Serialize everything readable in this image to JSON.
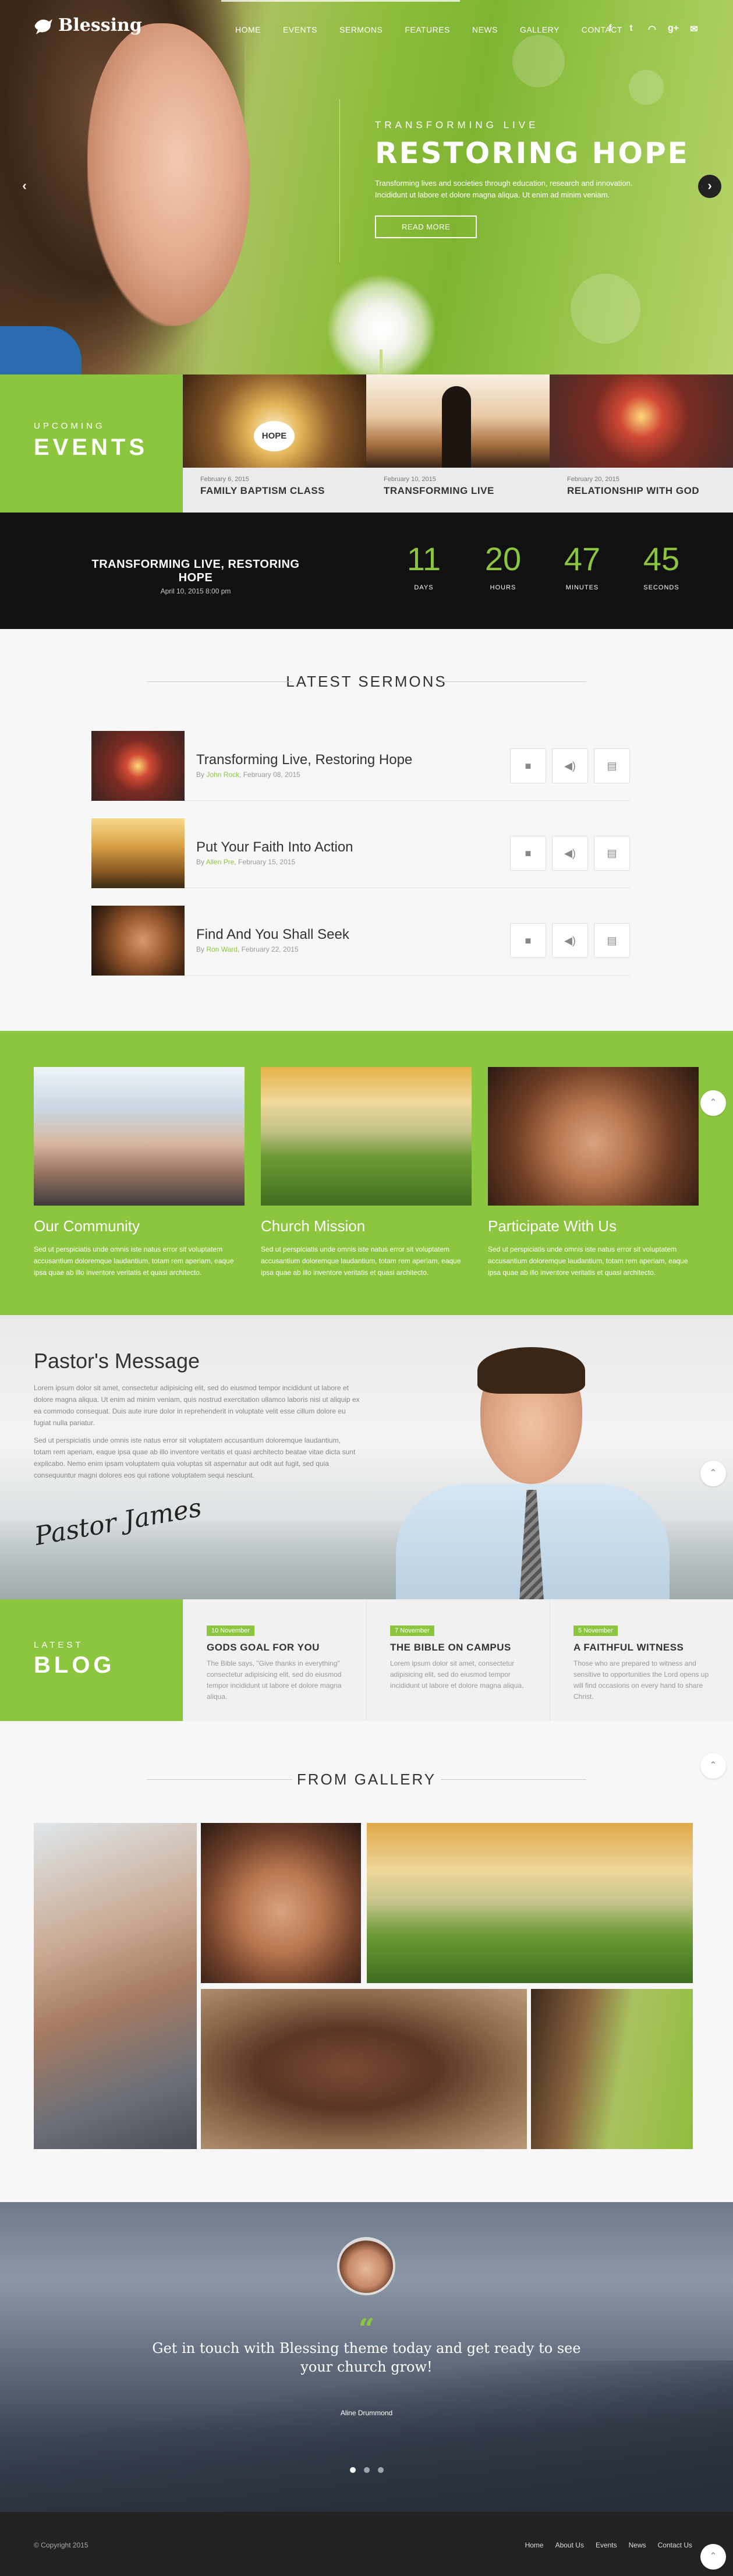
{
  "brand": {
    "name": "Blessing",
    "accent": "#8cc63f"
  },
  "nav": {
    "items": [
      "HOME",
      "EVENTS",
      "SERMONS",
      "FEATURES",
      "NEWS",
      "GALLERY",
      "CONTACT"
    ],
    "social": [
      {
        "icon": "facebook-icon",
        "glyph": "f"
      },
      {
        "icon": "twitter-icon",
        "glyph": "t"
      },
      {
        "icon": "rss-icon",
        "glyph": "◠"
      },
      {
        "icon": "google-plus-icon",
        "glyph": "g+"
      },
      {
        "icon": "mail-icon",
        "glyph": "✉"
      }
    ]
  },
  "hero": {
    "kicker": "TRANSFORMING LIVE",
    "title": "RESTORING HOPE",
    "text": "Transforming lives and societies through education, research and innovation. Incididunt ut labore et dolore magna aliqua. Ut enim ad minim veniam.",
    "button": "READ MORE",
    "prev": "‹",
    "next": "›"
  },
  "events": {
    "label_small": "UPCOMING",
    "label_big": "EVENTS",
    "items": [
      {
        "date": "February 6, 2015",
        "title": "FAMILY BAPTISM CLASS",
        "badge": "HOPE"
      },
      {
        "date": "February 10, 2015",
        "title": "TRANSFORMING LIVE"
      },
      {
        "date": "February 20, 2015",
        "title": "RELATIONSHIP WITH GOD"
      }
    ]
  },
  "countdown": {
    "event_title": "TRANSFORMING LIVE, RESTORING HOPE",
    "event_date": "April 10, 2015 8:00 pm",
    "units": [
      {
        "value": "11",
        "label": "DAYS"
      },
      {
        "value": "20",
        "label": "HOURS"
      },
      {
        "value": "47",
        "label": "MINUTES"
      },
      {
        "value": "45",
        "label": "SECONDS"
      }
    ]
  },
  "sermons": {
    "title": "LATEST SERMONS",
    "items": [
      {
        "title": "Transforming Live, Restoring Hope",
        "by": "By ",
        "author": "John Rock",
        "date": ", February 08, 2015"
      },
      {
        "title": "Put Your Faith Into Action",
        "by": "By ",
        "author": "Allen Pre",
        "date": ", February 15, 2015"
      },
      {
        "title": "Find And You Shall Seek",
        "by": "By ",
        "author": "Ron Ward",
        "date": ", February 22, 2015"
      }
    ],
    "buttons": [
      {
        "icon": "video-icon",
        "glyph": "■"
      },
      {
        "icon": "audio-icon",
        "glyph": "◀)"
      },
      {
        "icon": "pdf-icon",
        "glyph": "▤"
      }
    ]
  },
  "mission": {
    "cards": [
      {
        "title": "Our Community",
        "text": "Sed ut perspiciatis unde omnis iste natus error sit voluptatem accusantium doloremque laudantium, totam rem aperiam, eaque ipsa quae ab illo inventore veritatis et quasi architecto."
      },
      {
        "title": "Church Mission",
        "text": "Sed ut perspiciatis unde omnis iste natus error sit voluptatem accusantium doloremque laudantium, totam rem aperiam, eaque ipsa quae ab illo inventore veritatis et quasi architecto."
      },
      {
        "title": "Participate With Us",
        "text": "Sed ut perspiciatis unde omnis iste natus error sit voluptatem accusantium doloremque laudantium, totam rem aperiam, eaque ipsa quae ab illo inventore veritatis et quasi architecto."
      }
    ]
  },
  "pastor": {
    "title": "Pastor's Message",
    "p1": "Lorem ipsum dolor sit amet, consectetur adipisicing elit, sed do eiusmod tempor incididunt ut labore et dolore magna aliqua. Ut enim ad minim veniam, quis nostrud exercitation ullamco laboris nisi ut aliquip ex ea commodo consequat. Duis aute irure dolor in reprehenderit in voluptate velit esse cillum dolore eu fugiat nulla pariatur.",
    "p2": "Sed ut perspiciatis unde omnis iste natus error sit voluptatem accusantium doloremque laudantium, totam rem aperiam, eaque ipsa quae ab illo inventore veritatis et quasi architecto beatae vitae dicta sunt explicabo. Nemo enim ipsam voluptatem quia voluptas sit aspernatur aut odit aut fugit, sed quia consequuntur magni dolores eos qui ratione voluptatem sequi nesciunt.",
    "signature": "Pastor James"
  },
  "blog": {
    "label_small": "LATEST",
    "label_big": "BLOG",
    "items": [
      {
        "tag": "10 November",
        "title": "GODS GOAL FOR YOU",
        "text": "The Bible says, \"Give thanks in everything\" consectetur adipisicing elit, sed do eiusmod tempor incididunt ut labore et dolore magna aliqua."
      },
      {
        "tag": "7 November",
        "title": "THE BIBLE ON CAMPUS",
        "text": "Lorem ipsum dolor sit amet, consectetur adipisicing elit, sed do eiusmod tempor incididunt ut labore et dolore magna aliqua."
      },
      {
        "tag": "5 November",
        "title": "A FAITHFUL WITNESS",
        "text": "Those who are prepared to witness and sensitive to opportunities the Lord opens up will find occasions on every hand to share Christ."
      }
    ]
  },
  "gallery": {
    "title": "FROM GALLERY"
  },
  "testimonial": {
    "quote_mark": "“",
    "message": "Get in touch with Blessing theme today and get ready to see your church grow!",
    "author": "Aline Drummond",
    "dots": 3,
    "active_dot": 0
  },
  "footer": {
    "copyright": "© Copyright 2015",
    "links": [
      "Home",
      "About Us",
      "Events",
      "News",
      "Contact Us"
    ]
  },
  "scroll_top": "⌃"
}
